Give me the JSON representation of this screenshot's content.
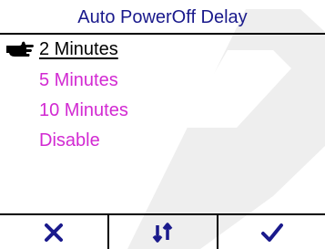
{
  "screen": {
    "title": "Auto PowerOff Delay"
  },
  "menu": {
    "items": [
      {
        "label": "2 Minutes",
        "selected": true
      },
      {
        "label": "5 Minutes",
        "selected": false
      },
      {
        "label": "10 Minutes",
        "selected": false
      },
      {
        "label": "Disable",
        "selected": false
      }
    ]
  },
  "softkeys": [
    {
      "icon": "close-icon"
    },
    {
      "icon": "sort-arrows-icon"
    },
    {
      "icon": "checkmark-icon"
    }
  ],
  "colors": {
    "title": "#1a1a8c",
    "item_unselected": "#d22ad2",
    "item_selected": "#000000",
    "softkey_icon": "#1a1a8c",
    "watermark": "#eeeeee"
  }
}
